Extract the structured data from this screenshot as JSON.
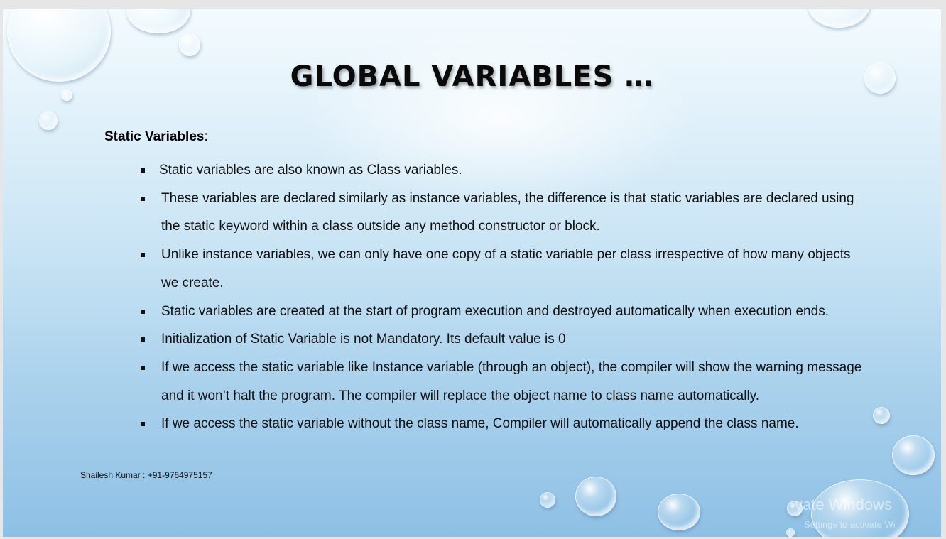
{
  "slide": {
    "title": "GLOBAL VARIABLES …",
    "section_heading": "Static Variables",
    "section_heading_suffix": ":",
    "bullets": [
      "Static variables are also known as Class variables.",
      "These variables are declared similarly as instance variables, the difference is that static variables are declared using the static keyword within a class outside any method constructor or block.",
      "Unlike instance variables, we can only have one copy of a static variable per class irrespective of how many objects we create.",
      "Static variables are created at the start of program execution and destroyed automatically when execution ends.",
      "Initialization of Static Variable is not Mandatory. Its default value is 0",
      "If we access the static variable like Instance variable (through an object), the compiler will show the warning message and it won’t halt the program. The compiler will replace the object name to class name automatically.",
      "If we access the static variable without the class name, Compiler will automatically append the class name."
    ],
    "footer": "Shailesh Kumar : +91-9764975157"
  },
  "watermark": {
    "line1": "vate Windows",
    "line2": "Settings to activate Wi"
  },
  "colors": {
    "title": "#0a0a0a",
    "body_text": "#111111",
    "background_top": "#f4fbfe",
    "background_bottom": "#8ec0e5"
  }
}
